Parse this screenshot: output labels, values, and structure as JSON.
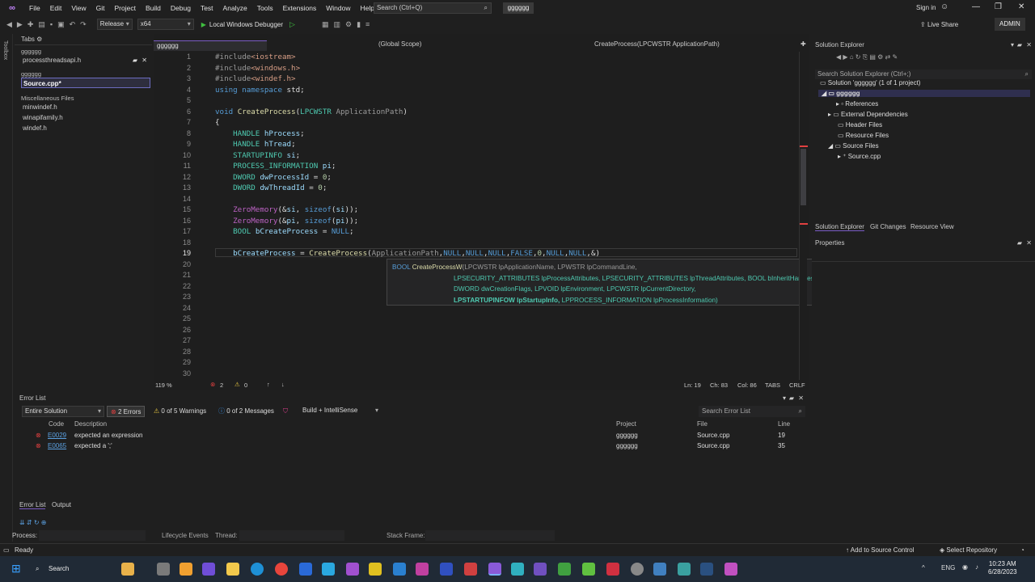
{
  "menu": {
    "items": [
      "File",
      "Edit",
      "View",
      "Git",
      "Project",
      "Build",
      "Debug",
      "Test",
      "Analyze",
      "Tools",
      "Extensions",
      "Window",
      "Help"
    ],
    "search_placeholder": "Search (Ctrl+Q)",
    "solution_name": "gggggg",
    "signin": "Sign in",
    "live_share": "Live Share",
    "admin": "ADMIN"
  },
  "toolbar": {
    "config": "Release",
    "platform": "x64",
    "debugger": "Local Windows Debugger"
  },
  "toolbox_label": "Toolbox",
  "tabs_panel": {
    "title": "Tabs",
    "groups": [
      {
        "name": "gggggg",
        "items": [
          "processthreadsapi.h"
        ]
      },
      {
        "name": "gggggg",
        "items": [
          "Source.cpp*"
        ]
      },
      {
        "name": "Miscellaneous Files",
        "items": [
          "minwindef.h",
          "winapifamily.h",
          "windef.h"
        ]
      }
    ]
  },
  "editor": {
    "file_tab": "gggggg",
    "scope": "(Global Scope)",
    "function_scope": "CreateProcess(LPCWSTR ApplicationPath)",
    "line_numbers": [
      "1",
      "2",
      "3",
      "4",
      "5",
      "6",
      "7",
      "8",
      "9",
      "10",
      "11",
      "12",
      "13",
      "14",
      "15",
      "16",
      "17",
      "18",
      "19",
      "20",
      "21",
      "22",
      "23",
      "24",
      "25",
      "26",
      "27",
      "28",
      "29",
      "30"
    ],
    "current_line": "19",
    "tooltip": {
      "line1_ret": "BOOL",
      "line1_fn": "CreateProcessW",
      "line1_rest": "(LPCWSTR lpApplicationName, LPWSTR lpCommandLine,",
      "line2": "LPSECURITY_ATTRIBUTES lpProcessAttributes, LPSECURITY_ATTRIBUTES lpThreadAttributes, BOOL bInheritHandles,",
      "line3": "DWORD dwCreationFlags, LPVOID lpEnvironment, LPCWSTR lpCurrentDirectory,",
      "line4_bold": "LPSTARTUPINFOW lpStartupInfo,",
      "line4_rest": " LPPROCESS_INFORMATION lpProcessInformation)"
    },
    "status": {
      "zoom": "119 %",
      "errors": "2",
      "warnings": "0",
      "ln": "Ln: 19",
      "ch": "Ch: 83",
      "col": "Col: 86",
      "tabs": "TABS",
      "eol": "CRLF"
    }
  },
  "solution_explorer": {
    "title": "Solution Explorer",
    "search_placeholder": "Search Solution Explorer (Ctrl+;)",
    "tree": [
      "Solution 'gggggg' (1 of 1 project)",
      "gggggg",
      "References",
      "External Dependencies",
      "Header Files",
      "Resource Files",
      "Source Files",
      "Source.cpp"
    ],
    "bottom_tabs": [
      "Solution Explorer",
      "Git Changes",
      "Resource View"
    ],
    "properties_title": "Properties"
  },
  "error_list": {
    "title": "Error List",
    "scope": "Entire Solution",
    "errors_chip": "2 Errors",
    "warnings_chip": "0 of 5 Warnings",
    "messages_chip": "0 of 2 Messages",
    "build_filter": "Build + IntelliSense",
    "search_placeholder": "Search Error List",
    "columns": [
      "Code",
      "Description",
      "Project",
      "File",
      "Line"
    ],
    "rows": [
      {
        "code": "E0029",
        "description": "expected an expression",
        "project": "gggggg",
        "file": "Source.cpp",
        "line": "19"
      },
      {
        "code": "E0065",
        "description": "expected a ';'",
        "project": "gggggg",
        "file": "Source.cpp",
        "line": "35"
      }
    ],
    "bottom_tabs": [
      "Error List",
      "Output"
    ]
  },
  "process_bar": {
    "process_label": "Process:",
    "lifecycle_label": "Lifecycle Events",
    "thread_label": "Thread:",
    "stackframe_label": "Stack Frame:"
  },
  "statusbar": {
    "ready": "Ready",
    "add_source": "Add to Source Control",
    "select_repo": "Select Repository"
  },
  "taskbar": {
    "search": "Search",
    "lang": "ENG",
    "time": "10:23 AM",
    "date": "6/28/2023"
  }
}
